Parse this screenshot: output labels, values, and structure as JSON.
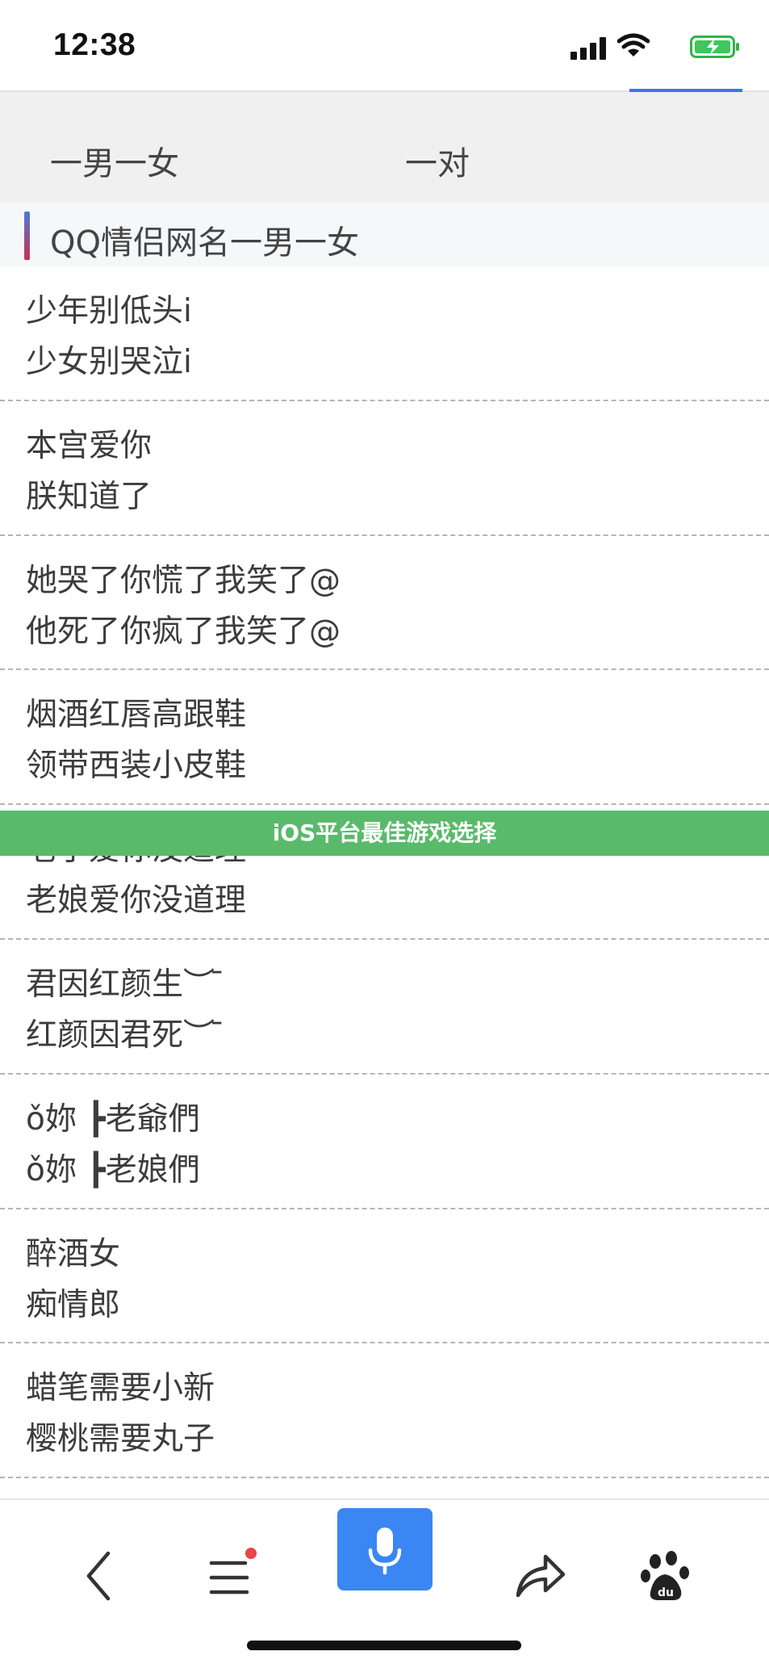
{
  "status_bar": {
    "time": "12:38"
  },
  "tabs": [
    {
      "label": "一男一女"
    },
    {
      "label": "一对"
    }
  ],
  "section": {
    "title": "QQ情侣网名一男一女"
  },
  "pairs": [
    {
      "line1": "少年别低头i",
      "line2": "少女别哭泣i"
    },
    {
      "line1": "本宫爱你",
      "line2": "朕知道了"
    },
    {
      "line1": "她哭了你慌了我笑了@",
      "line2": "他死了你疯了我笑了@"
    },
    {
      "line1": "烟酒红唇高跟鞋",
      "line2": "领带西装小皮鞋"
    },
    {
      "line1": "老子爱你没道理",
      "line2": "老娘爱你没道理"
    },
    {
      "line1": "君因红颜生︶ ̄",
      "line2": "红颜因君死︶ ̄"
    },
    {
      "line1": "ǒ妳 ┣老爺們",
      "line2": "ǒ妳 ┣老娘們"
    },
    {
      "line1": "醉酒女",
      "line2": "痴情郎"
    },
    {
      "line1": "蜡笔需要小新",
      "line2": "樱桃需要丸子"
    }
  ],
  "banner": {
    "text": "iOS平台最佳游戏选择",
    "color": "#5aba6b"
  },
  "toolbar": {
    "icons": [
      "back-icon",
      "menu-icon",
      "microphone-icon",
      "share-icon",
      "baidu-paw-icon"
    ],
    "accent": "#3a86f2",
    "notification_dot_color": "#e8454a"
  }
}
